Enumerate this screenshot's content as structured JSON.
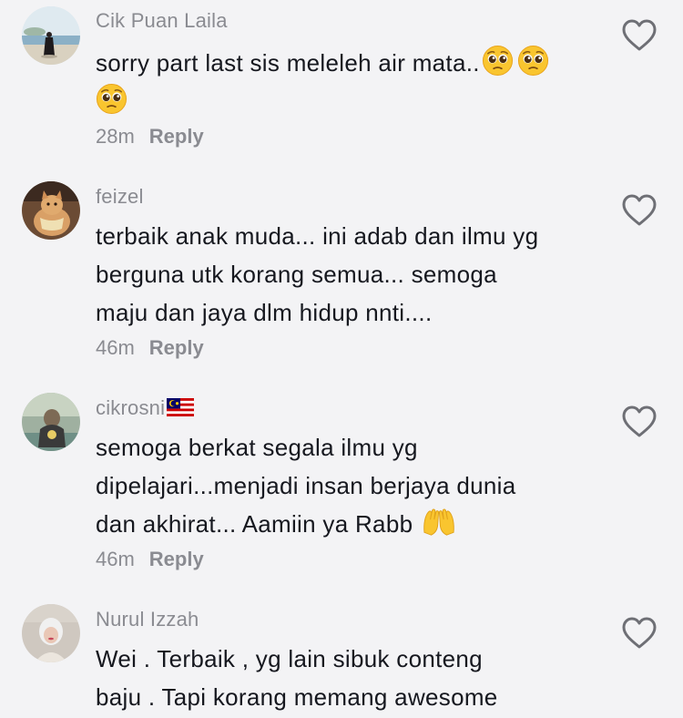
{
  "comments": [
    {
      "username": "Cik Puan Laila",
      "lines": [
        "sorry part last sis meleleh air mata..",
        ""
      ],
      "time": "28m",
      "reply_label": "Reply"
    },
    {
      "username": "feizel",
      "lines": [
        "terbaik anak muda... ini adab dan ilmu yg",
        "berguna utk korang semua... semoga",
        "maju dan jaya dlm hidup nnti...."
      ],
      "time": "46m",
      "reply_label": "Reply"
    },
    {
      "username": "cikrosni",
      "lines": [
        "semoga berkat segala ilmu yg",
        "dipelajari...menjadi insan berjaya dunia",
        "dan akhirat... Aamiin ya Rabb"
      ],
      "time": "46m",
      "reply_label": "Reply"
    },
    {
      "username": "Nurul Izzah",
      "lines": [
        "Wei . Terbaik , yg lain sibuk conteng",
        "baju . Tapi korang memang awesome"
      ]
    }
  ],
  "icons": {
    "like": "heart-outline-icon",
    "pleading_face": "pleading-face-emoji",
    "raising_hands": "raising-hands-emoji",
    "flag": "malaysia-flag-emoji"
  },
  "colors": {
    "background": "#f3f3f5",
    "text": "#16181f",
    "secondary": "#8a8b91"
  }
}
